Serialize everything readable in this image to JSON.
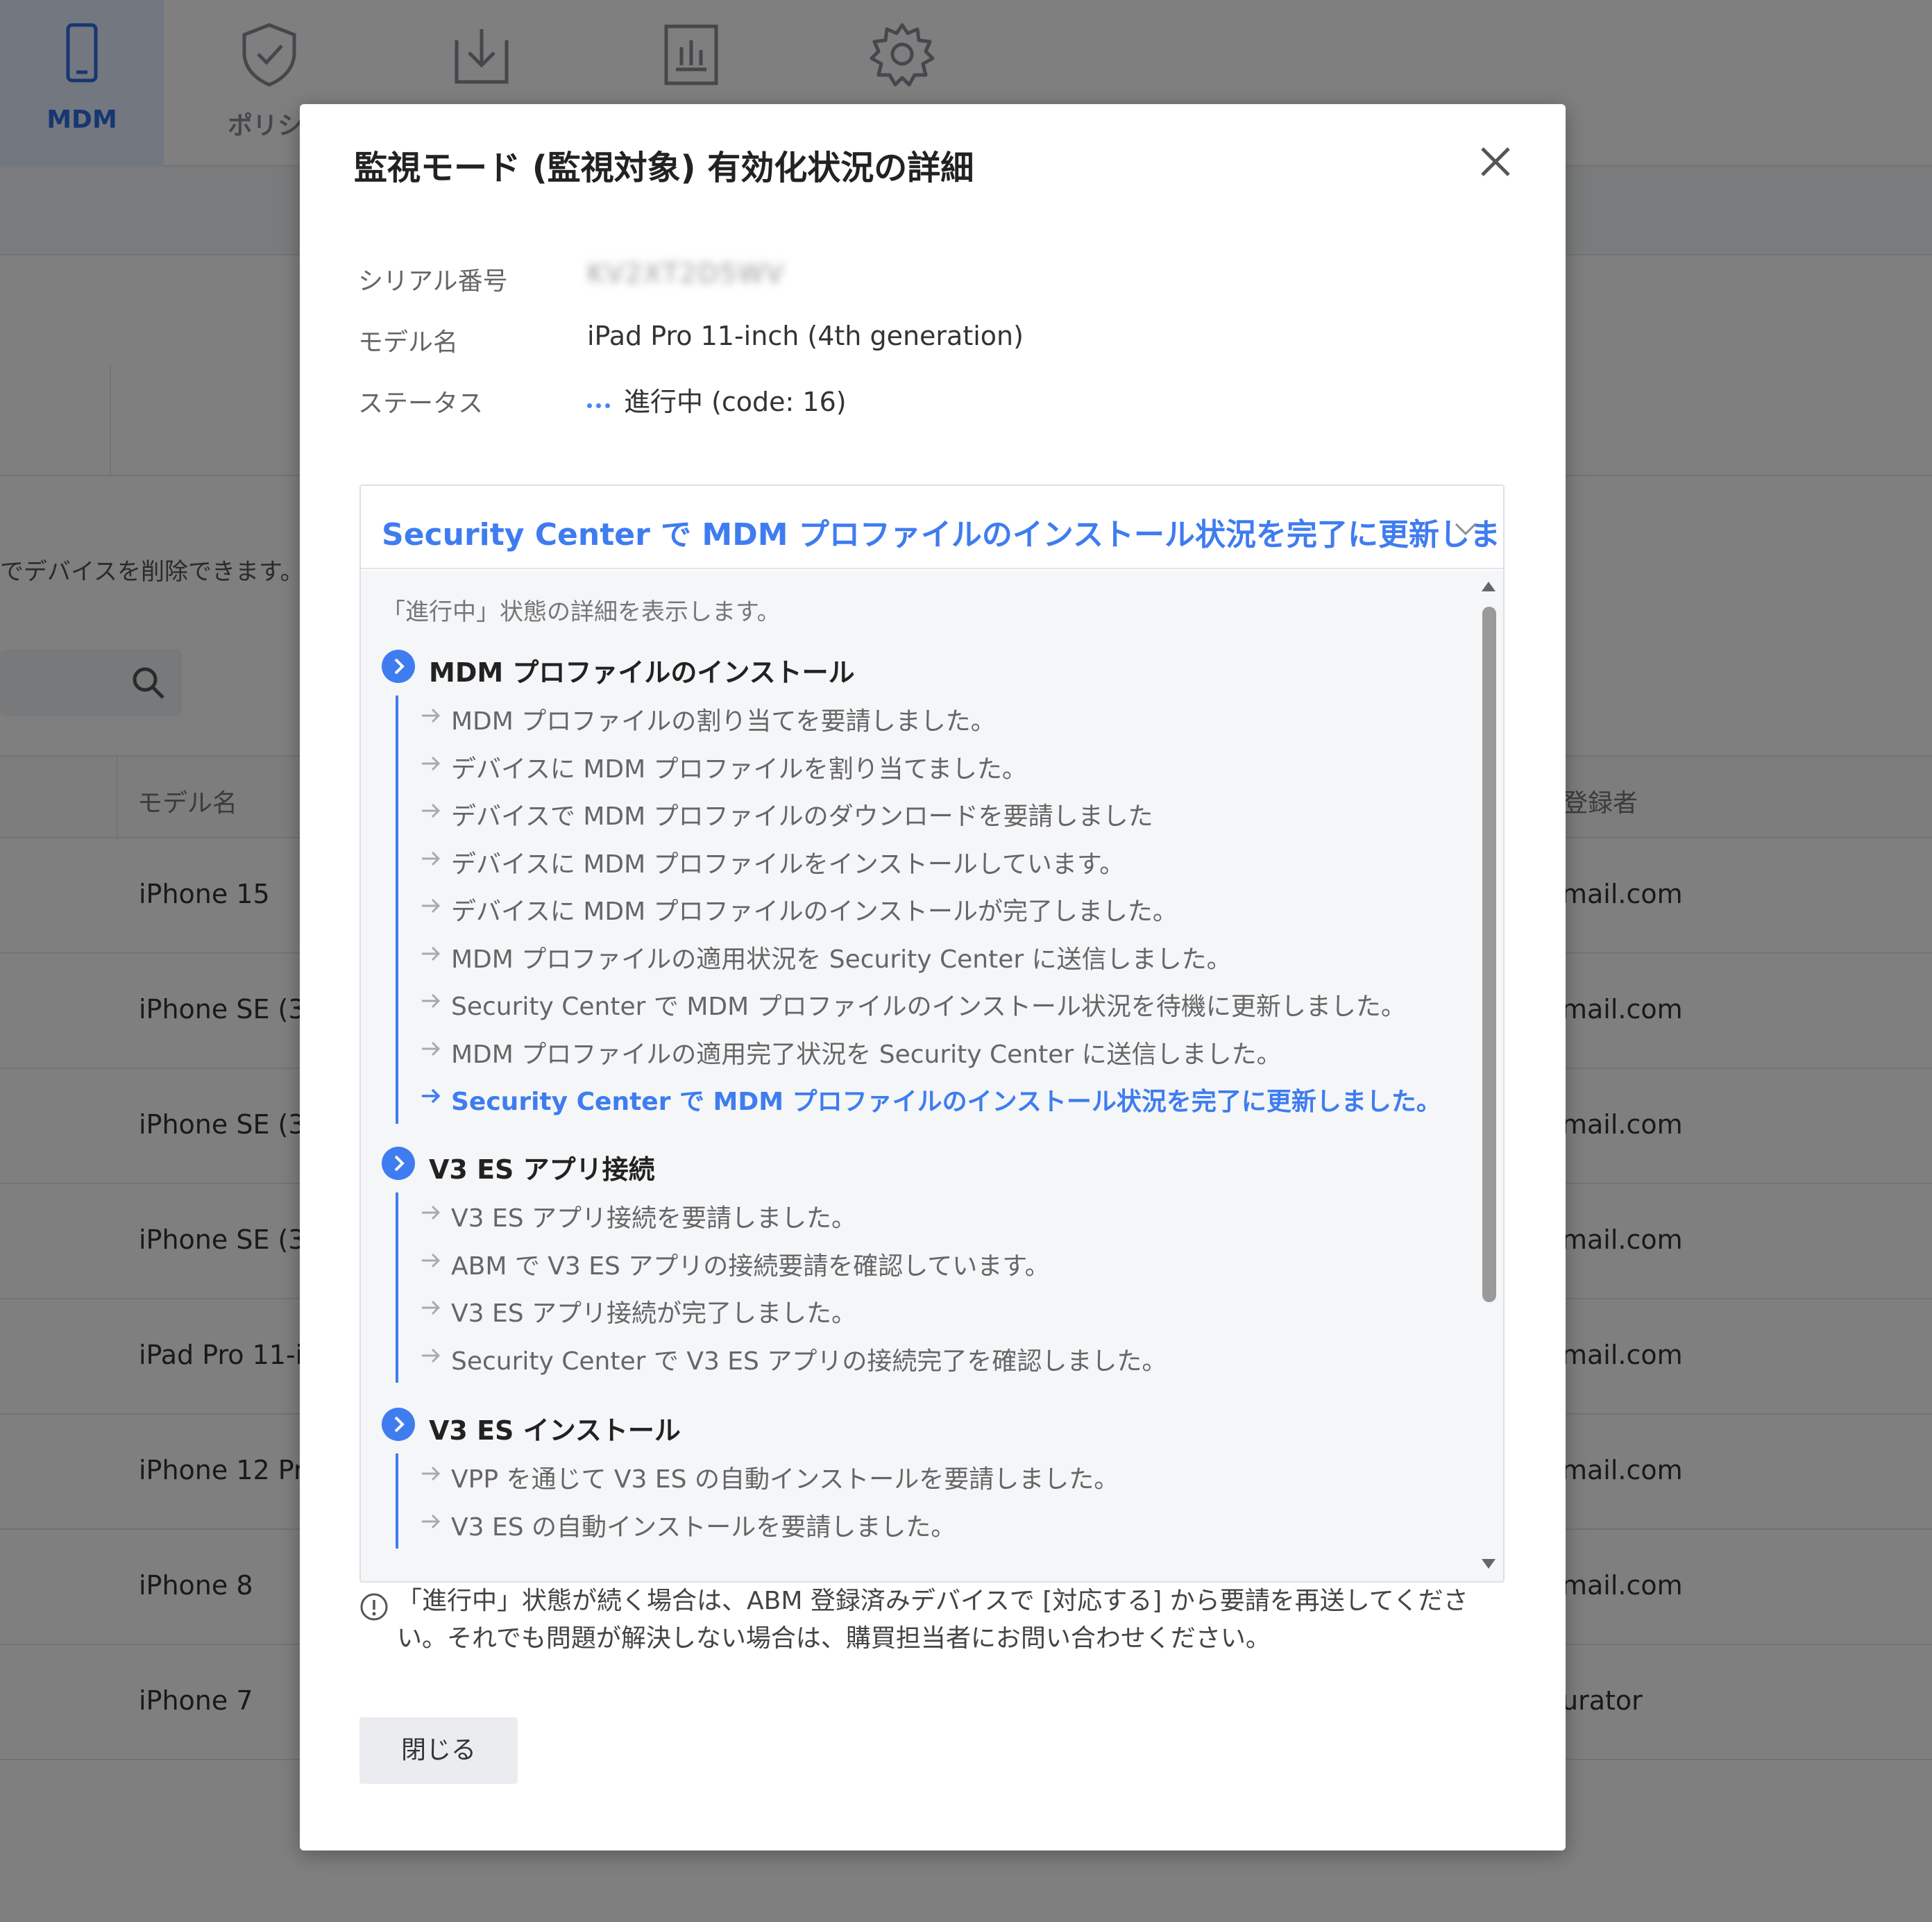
{
  "nav": {
    "items": [
      {
        "label": "MDM",
        "icon": "phone-icon",
        "active": true
      },
      {
        "label": "ポリシー",
        "icon": "shield-check-icon",
        "active": false
      },
      {
        "label": "",
        "icon": "download-icon",
        "active": false
      },
      {
        "label": "",
        "icon": "report-icon",
        "active": false
      },
      {
        "label": "",
        "icon": "gear-icon",
        "active": false
      }
    ]
  },
  "background": {
    "description": "でデバイスを削除できます。「進行",
    "table_headers": {
      "model": "モデル名",
      "registrant": "登録者"
    },
    "rows": [
      {
        "model": "iPhone 15",
        "user": "mail.com"
      },
      {
        "model": "iPhone SE (3",
        "user": "mail.com"
      },
      {
        "model": "iPhone SE (3",
        "user": "mail.com"
      },
      {
        "model": "iPhone SE (3",
        "user": "mail.com"
      },
      {
        "model": "iPad Pro 11-i",
        "user": "mail.com"
      },
      {
        "model": "iPhone 12 Pr",
        "user": "mail.com"
      },
      {
        "model": "iPhone 8",
        "user": "mail.com"
      },
      {
        "model": "iPhone 7",
        "user": "urator"
      }
    ]
  },
  "modal": {
    "title": "監視モード (監視対象) 有効化状況の詳細",
    "fields": {
      "serial_label": "シリアル番号",
      "serial_value": "KV2XT2D5WV",
      "model_label": "モデル名",
      "model_value": "iPad Pro 11-inch (4th generation)",
      "status_label": "ステータス",
      "status_value": "進行中 (code: 16)"
    },
    "panel": {
      "header": "Security Center で MDM プロファイルのインストール状況を完了に更新しました。",
      "intro": "「進行中」状態の詳細を表示します。",
      "sections": [
        {
          "title": "MDM プロファイルのインストール",
          "steps": [
            "MDM プロファイルの割り当てを要請しました。",
            "デバイスに MDM プロファイルを割り当てました。",
            "デバイスで MDM プロファイルのダウンロードを要請しました",
            "デバイスに MDM プロファイルをインストールしています。",
            "デバイスに MDM プロファイルのインストールが完了しました。",
            "MDM プロファイルの適用状況を Security Center に送信しました。",
            "Security Center で MDM プロファイルのインストール状況を待機に更新しました。",
            "MDM プロファイルの適用完了状況を Security Center に送信しました。",
            "Security Center で MDM プロファイルのインストール状況を完了に更新しました。"
          ]
        },
        {
          "title": "V3 ES アプリ接続",
          "steps": [
            "V3 ES アプリ接続を要請しました。",
            "ABM で V3 ES アプリの接続要請を確認しています。",
            "V3 ES アプリ接続が完了しました。",
            "Security Center で V3 ES アプリの接続完了を確認しました。"
          ]
        },
        {
          "title": "V3 ES インストール",
          "steps": [
            "VPP を通じて V3 ES の自動インストールを要請しました。",
            "V3 ES の自動インストールを要請しました。"
          ]
        }
      ]
    },
    "notice": "「進行中」状態が続く場合は、ABM 登録済みデバイスで [対応する] から要請を再送してください。それでも問題が解決しない場合は、購買担当者にお問い合わせください。",
    "close_button": "閉じる"
  },
  "colors": {
    "accent": "#3f7cf0",
    "overlay": "rgba(0,0,0,0.5)"
  }
}
